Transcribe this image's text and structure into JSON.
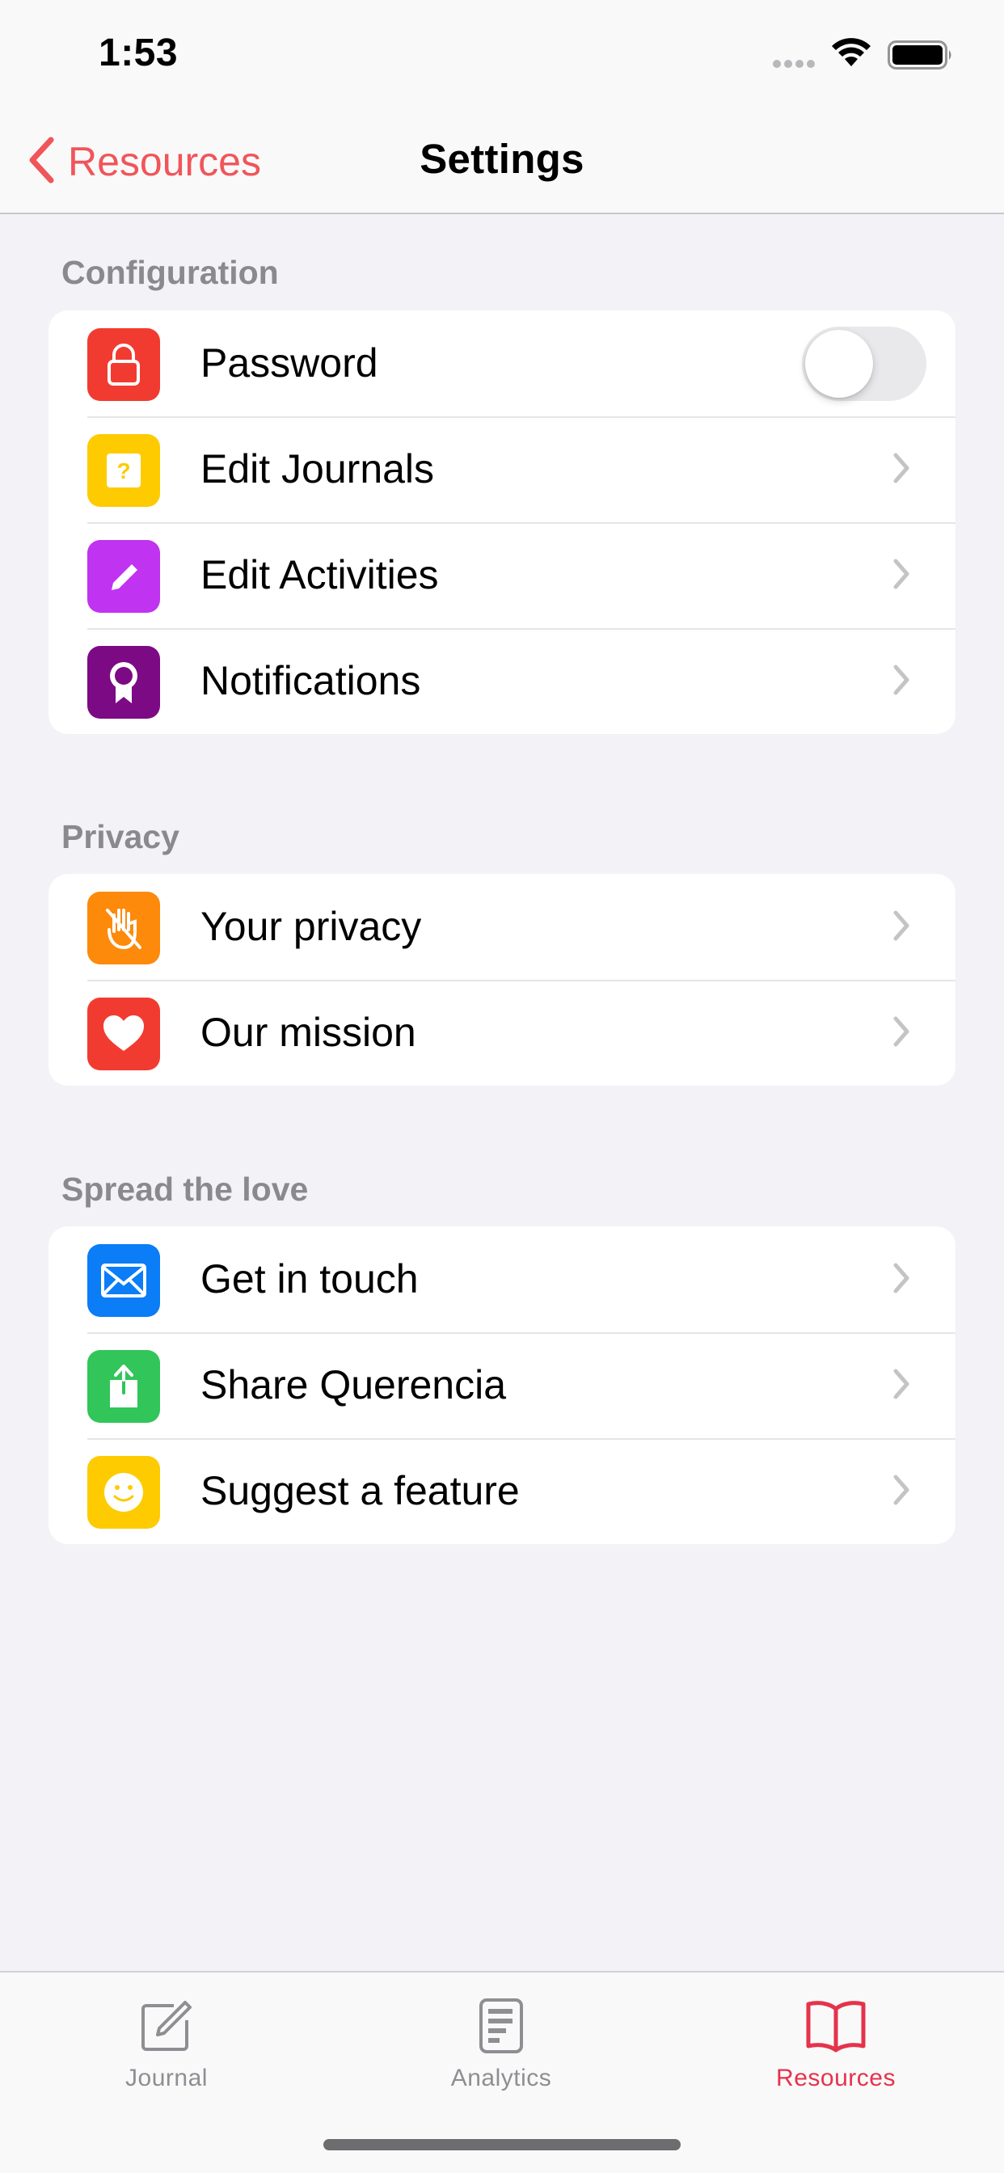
{
  "status_bar": {
    "time": "1:53"
  },
  "nav": {
    "back_label": "Resources",
    "title": "Settings"
  },
  "colors": {
    "accent": "#f0555a",
    "active_tab": "#e5334c"
  },
  "sections": [
    {
      "header": "Configuration",
      "rows": [
        {
          "label": "Password",
          "icon": "lock-icon",
          "icon_color": "#f23b30",
          "accessory": "toggle",
          "toggle_on": false
        },
        {
          "label": "Edit Journals",
          "icon": "question-card-icon",
          "icon_color": "#fdcb00",
          "accessory": "chevron"
        },
        {
          "label": "Edit Activities",
          "icon": "pencil-icon",
          "icon_color": "#c033f0",
          "accessory": "chevron"
        },
        {
          "label": "Notifications",
          "icon": "ribbon-badge-icon",
          "icon_color": "#7c0a85",
          "accessory": "chevron"
        }
      ]
    },
    {
      "header": "Privacy",
      "rows": [
        {
          "label": "Your privacy",
          "icon": "hand-slash-icon",
          "icon_color": "#fd8a0a",
          "accessory": "chevron"
        },
        {
          "label": "Our mission",
          "icon": "heart-icon",
          "icon_color": "#f23b30",
          "accessory": "chevron"
        }
      ]
    },
    {
      "header": "Spread the love",
      "rows": [
        {
          "label": "Get in touch",
          "icon": "envelope-icon",
          "icon_color": "#0a7df7",
          "accessory": "chevron"
        },
        {
          "label": "Share Querencia",
          "icon": "share-icon",
          "icon_color": "#31c55a",
          "accessory": "chevron"
        },
        {
          "label": "Suggest a feature",
          "icon": "smiley-icon",
          "icon_color": "#fdcb00",
          "accessory": "chevron"
        }
      ]
    }
  ],
  "tabs": [
    {
      "label": "Journal",
      "icon": "compose-icon",
      "active": false
    },
    {
      "label": "Analytics",
      "icon": "document-icon",
      "active": false
    },
    {
      "label": "Resources",
      "icon": "book-icon",
      "active": true
    }
  ]
}
